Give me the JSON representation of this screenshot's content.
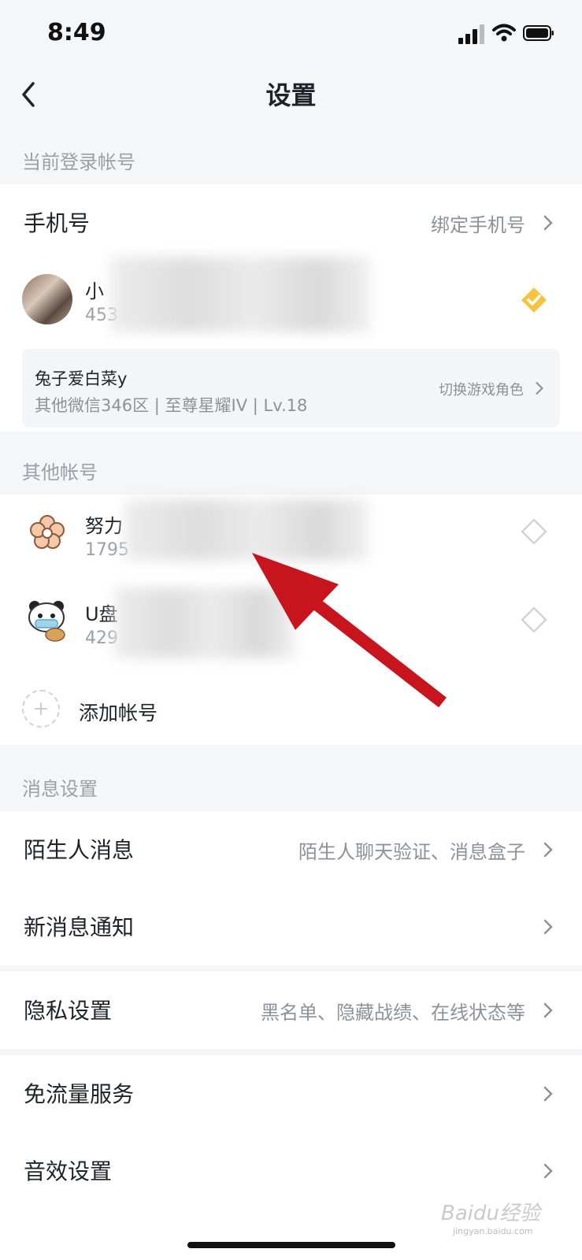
{
  "status_bar": {
    "time": "8:49"
  },
  "nav": {
    "title": "设置"
  },
  "sections": {
    "current_account": "当前登录帐号",
    "other_accounts": "其他帐号",
    "message_settings": "消息设置"
  },
  "phone_row": {
    "label": "手机号",
    "value": "绑定手机号"
  },
  "current_account": {
    "name_prefix": "小",
    "id_prefix": "453"
  },
  "role_card": {
    "name": "兔子爱白菜y",
    "desc": "其他微信346区 | 至尊星耀IV | Lv.18",
    "switch_label": "切换游戏角色"
  },
  "other_accounts": [
    {
      "name_prefix": "努力",
      "id_prefix": "1795"
    },
    {
      "name_prefix": "U盘",
      "id_prefix": "429"
    }
  ],
  "add_account_label": "添加帐号",
  "rows": {
    "stranger": {
      "label": "陌生人消息",
      "value": "陌生人聊天验证、消息盒子"
    },
    "new_msg": {
      "label": "新消息通知"
    },
    "privacy": {
      "label": "隐私设置",
      "value": "黑名单、隐藏战绩、在线状态等"
    },
    "free_data": {
      "label": "免流量服务"
    },
    "sound": {
      "label": "音效设置"
    }
  },
  "watermark": {
    "brand": "Baidu经验",
    "url": "jingyan.baidu.com"
  },
  "colors": {
    "accent_gold": "#f7c442",
    "annotation_red": "#c8141c",
    "background": "#f5f6f8"
  }
}
